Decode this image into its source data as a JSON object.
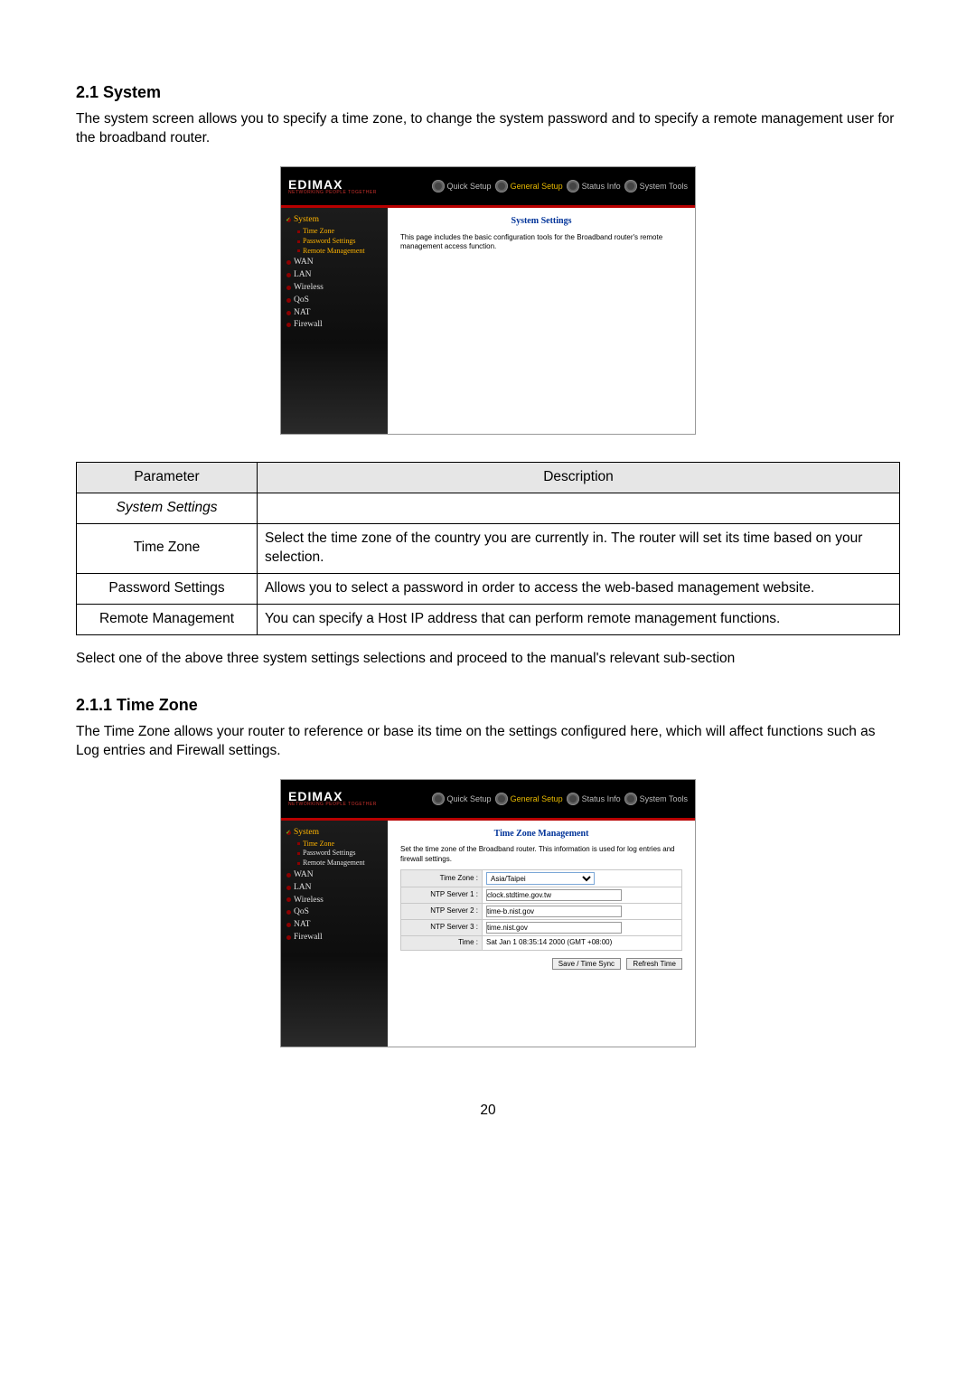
{
  "section1": {
    "heading": "2.1 System",
    "intro": "The system screen allows you to specify a time zone, to change the system password and to specify a remote management user for the broadband router.",
    "outro": "Select one of the above three system settings selections and proceed to the manual's relevant sub-section"
  },
  "section2": {
    "heading": "2.1.1 Time Zone",
    "intro": "The Time Zone allows your router to reference or base its time on the settings configured here, which will affect functions such as Log entries and Firewall settings."
  },
  "router": {
    "brand": "EDIMAX",
    "brand_sub": "NETWORKING PEOPLE TOGETHER",
    "tabs": [
      "Quick Setup",
      "General Setup",
      "Status Info",
      "System Tools"
    ],
    "nav": {
      "system": "System",
      "timezone": "Time Zone",
      "password": "Password Settings",
      "remote": "Remote Management",
      "wan": "WAN",
      "lan": "LAN",
      "wireless": "Wireless",
      "qos": "QoS",
      "nat": "NAT",
      "firewall": "Firewall"
    }
  },
  "shot1": {
    "title": "System Settings",
    "desc": "This page includes the basic configuration tools for the Broadband router's remote management access function."
  },
  "shot2": {
    "title": "Time Zone Management",
    "desc": "Set the time zone of the Broadband router. This information is used for log entries and firewall settings.",
    "rows": {
      "tz_label": "Time Zone :",
      "tz_value": "Asia/Taipei",
      "ntp1_label": "NTP Server 1 :",
      "ntp1_value": "clock.stdtime.gov.tw",
      "ntp2_label": "NTP Server 2 :",
      "ntp2_value": "time-b.nist.gov",
      "ntp3_label": "NTP Server 3 :",
      "ntp3_value": "time.nist.gov",
      "time_label": "Time :",
      "time_value": "Sat Jan 1 08:35:14 2000 (GMT +08:00)"
    },
    "buttons": {
      "save": "Save / Time Sync",
      "refresh": "Refresh Time"
    }
  },
  "param_table": {
    "headers": {
      "param": "Parameter",
      "desc": "Description"
    },
    "rows": [
      {
        "param": "System Settings",
        "desc": "",
        "italic": true
      },
      {
        "param": "Time Zone",
        "desc": "Select the time zone of the country you are currently in. The router will set its time based on your selection."
      },
      {
        "param": "Password Settings",
        "desc": "Allows you to select a password in order to access the web-based management website."
      },
      {
        "param": "Remote Management",
        "desc": "You can specify a Host IP address that can perform remote management functions."
      }
    ]
  },
  "page_number": "20"
}
